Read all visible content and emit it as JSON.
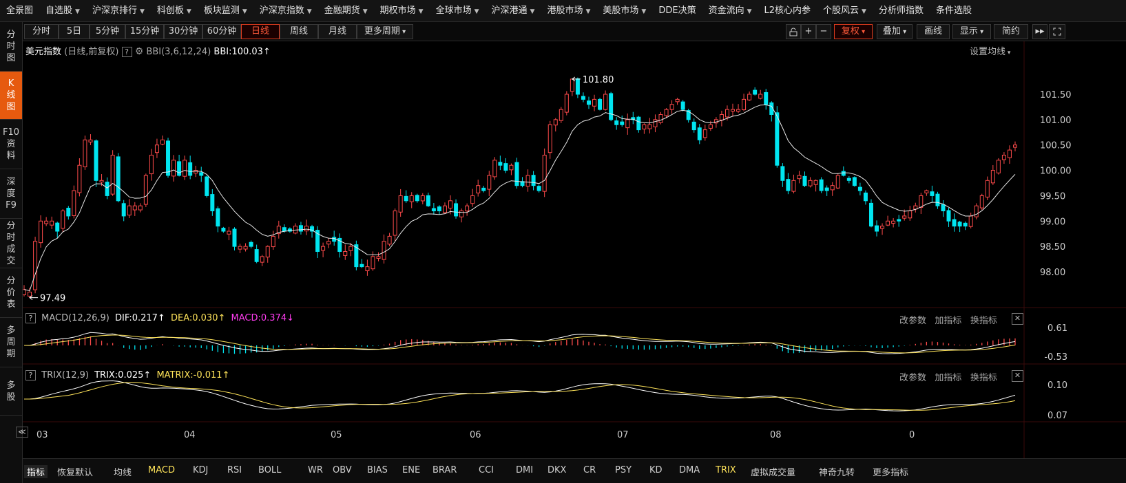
{
  "menubar": {
    "items": [
      {
        "label": "全景图",
        "caret": false
      },
      {
        "label": "自选股",
        "caret": true
      },
      {
        "label": "沪深京排行",
        "caret": true
      },
      {
        "label": "科创板",
        "caret": true
      },
      {
        "label": "板块监测",
        "caret": true
      },
      {
        "label": "沪深京指数",
        "caret": true
      },
      {
        "label": "金融期货",
        "caret": true
      },
      {
        "label": "期权市场",
        "caret": true
      },
      {
        "label": "全球市场",
        "caret": true
      },
      {
        "label": "沪深港通",
        "caret": true
      },
      {
        "label": "港股市场",
        "caret": true
      },
      {
        "label": "美股市场",
        "caret": true
      },
      {
        "label": "DDE决策",
        "caret": false
      },
      {
        "label": "资金流向",
        "caret": true
      },
      {
        "label": "L2核心内参",
        "caret": false
      },
      {
        "label": "个股风云",
        "caret": true
      },
      {
        "label": "分析师指数",
        "caret": false
      },
      {
        "label": "条件选股",
        "caret": false
      }
    ]
  },
  "sidebar": {
    "tabs": [
      {
        "label": "分时图",
        "active": false
      },
      {
        "label": "K线图",
        "active": true
      },
      {
        "label": "F10资料",
        "active": false
      },
      {
        "label": "深度F9",
        "active": false
      },
      {
        "label": "分时成交",
        "active": false
      },
      {
        "label": "分价表",
        "active": false
      },
      {
        "label": "多周期",
        "active": false
      },
      {
        "label": "多股",
        "active": false
      }
    ]
  },
  "toolbar": {
    "periods": [
      "分时",
      "5日",
      "5分钟",
      "15分钟",
      "30分钟",
      "60分钟",
      "日线",
      "周线",
      "月线",
      "更多周期"
    ],
    "active_period": "日线",
    "right": {
      "lock_icon": "lock-icon",
      "plus": "+",
      "minus": "−",
      "adjust": "复权",
      "overlay": "叠加",
      "draw": "画线",
      "display": "显示",
      "simple": "简约",
      "expand": "▸▸",
      "fullscreen_icon": "fullscreen-icon"
    }
  },
  "main_panel": {
    "title": "美元指数",
    "subtitle": "(日线,前复权)",
    "help": "?",
    "settings_icon": "gear-icon",
    "indicator": "BBI(3,6,12,24)",
    "bbi_value": "BBI:100.03",
    "bbi_arrow": "↑",
    "set_ma": "设置均线",
    "high_label": "101.80",
    "low_label": "97.49"
  },
  "macd_panel": {
    "help": "?",
    "name": "MACD(12,26,9)",
    "dif": "DIF:0.217",
    "dif_arrow": "↑",
    "dea": "DEA:0.030",
    "dea_arrow": "↑",
    "macd": "MACD:0.374",
    "macd_arrow": "↓",
    "actions": [
      "改参数",
      "加指标",
      "换指标"
    ],
    "close": "✕",
    "axis": [
      "0.61",
      "-0.53"
    ]
  },
  "trix_panel": {
    "help": "?",
    "name": "TRIX(12,9)",
    "trix": "TRIX:0.025",
    "trix_arrow": "↑",
    "matrix": "MATRIX:-0.011",
    "matrix_arrow": "↑",
    "actions": [
      "改参数",
      "加指标",
      "换指标"
    ],
    "close": "✕",
    "axis": [
      "0.10",
      "0.07"
    ]
  },
  "x_axis": {
    "back": "≪",
    "months": [
      "03",
      "04",
      "05",
      "06",
      "07",
      "08",
      "0"
    ]
  },
  "bottombar": {
    "items": [
      "指标",
      "恢复默认",
      "均线",
      "MACD",
      "KDJ",
      "RSI",
      "BOLL",
      "WR",
      "OBV",
      "BIAS",
      "ENE",
      "BRAR",
      "CCI",
      "DMI",
      "DKX",
      "CR",
      "PSY",
      "KD",
      "DMA",
      "TRIX",
      "虚拟成交量",
      "神奇九转",
      "更多指标"
    ],
    "highlighted": [
      "MACD",
      "TRIX"
    ]
  },
  "colors": {
    "up": "#ff4b4b",
    "down": "#00e5f0",
    "ma": "#ffffff",
    "accent": "#e65a0f",
    "dea": "#ffe45a",
    "macd": "#ff3df0"
  },
  "chart_data": {
    "type": "candlestick",
    "title": "美元指数",
    "y_ticks": [
      101.5,
      101.0,
      100.5,
      100.0,
      99.5,
      99.0,
      98.5,
      98.0
    ],
    "ylim": [
      97.3,
      102.3
    ],
    "x_ticks": [
      "03",
      "04",
      "05",
      "06",
      "07",
      "08",
      "0"
    ],
    "annotations": [
      {
        "label": "101.80",
        "value": 101.8
      },
      {
        "label": "97.49",
        "value": 97.49
      }
    ],
    "close": [
      97.65,
      97.6,
      98.6,
      99.0,
      99.0,
      99.0,
      98.8,
      99.2,
      99.1,
      99.6,
      100.1,
      100.6,
      100.6,
      99.8,
      99.8,
      99.5,
      100.3,
      99.4,
      99.1,
      99.3,
      99.3,
      99.3,
      99.9,
      100.3,
      100.5,
      100.6,
      99.9,
      100.2,
      99.9,
      100.2,
      99.9,
      100.0,
      99.9,
      99.5,
      99.2,
      98.9,
      98.8,
      98.8,
      98.5,
      98.5,
      98.5,
      98.5,
      98.2,
      98.3,
      98.5,
      98.7,
      98.9,
      98.8,
      98.8,
      98.9,
      98.8,
      98.9,
      98.8,
      98.4,
      98.5,
      98.6,
      98.6,
      98.4,
      98.4,
      98.5,
      98.1,
      98.1,
      98.1,
      98.3,
      98.3,
      98.6,
      98.7,
      99.2,
      99.5,
      99.4,
      99.5,
      99.4,
      99.5,
      99.3,
      99.2,
      99.2,
      99.3,
      99.4,
      99.1,
      99.2,
      99.3,
      99.5,
      99.7,
      99.6,
      99.9,
      100.2,
      100.1,
      100.0,
      100.1,
      99.7,
      99.7,
      99.9,
      99.7,
      99.6,
      100.3,
      100.9,
      101.0,
      101.2,
      101.5,
      101.8,
      101.5,
      101.4,
      101.3,
      101.4,
      101.2,
      101.5,
      101.0,
      100.9,
      100.9,
      101.0,
      101.0,
      100.8,
      100.9,
      100.9,
      101.0,
      101.1,
      101.2,
      101.3,
      101.4,
      101.2,
      101.0,
      100.8,
      100.6,
      100.8,
      100.9,
      101.0,
      101.1,
      101.2,
      101.2,
      101.2,
      101.4,
      101.5,
      101.5,
      101.5,
      101.3,
      101.1,
      100.1,
      99.8,
      99.6,
      99.8,
      99.9,
      99.7,
      99.8,
      99.8,
      99.6,
      99.6,
      99.7,
      99.9,
      99.9,
      99.8,
      99.7,
      99.6,
      99.4,
      98.9,
      98.8,
      98.9,
      99.0,
      99.0,
      99.0,
      99.1,
      99.2,
      99.3,
      99.5,
      99.6,
      99.5,
      99.3,
      99.2,
      99.0,
      98.9,
      98.9,
      98.9,
      99.1,
      99.3,
      99.5,
      99.8,
      100.0,
      100.2,
      100.3,
      100.4,
      100.5
    ]
  }
}
